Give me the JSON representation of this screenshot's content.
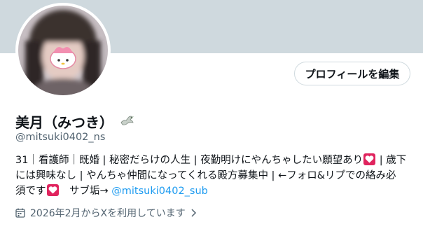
{
  "profile": {
    "edit_button_label": "プロフィールを編集",
    "display_name": "美月（みつき）",
    "handle": "@mitsuki0402_ns",
    "bio": {
      "line1_a": "31｜看護師｜既婚 | 秘密だらけの人生 | 夜勤明けにやんちゃしたい願望あり",
      "line1_b": " | 歳下",
      "line2": "には興味なし | やんちゃ仲間になってくれる殿方募集中 | ←フォロ&リプでの絡み必",
      "line3_a": "須です",
      "line3_b": "　サブ垢→ ",
      "line3_mention": "@mitsuki0402_sub"
    },
    "joined_text": "2026年2月からXを利用しています"
  },
  "colors": {
    "banner": "#cfd9de",
    "accent": "#1d9bf0",
    "heart": "#e0245e",
    "secondary_text": "#536471"
  },
  "icons": {
    "name_badge": "dove-icon",
    "heart": "heart-icon",
    "joined": "calendar-icon",
    "more": "chevron-right-icon"
  }
}
